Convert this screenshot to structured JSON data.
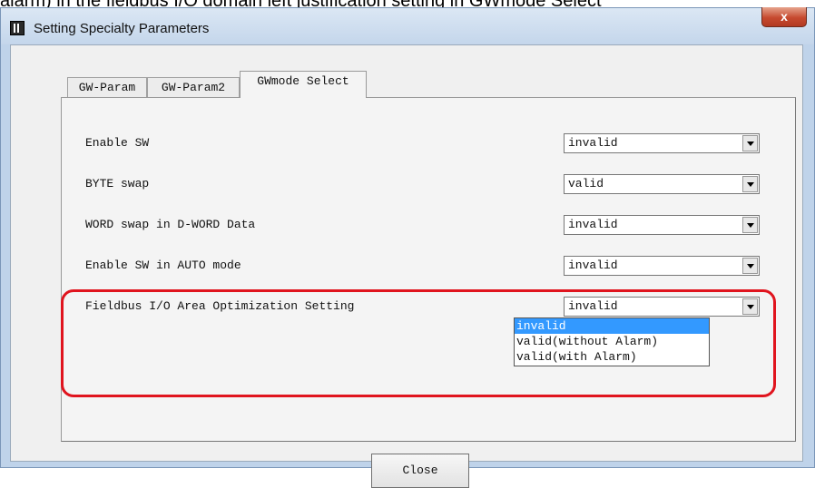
{
  "caption": "alarm) in the fieldbus I/O domain left justification setting in GWmode Select",
  "window": {
    "title": "Setting Specialty Parameters",
    "close_glyph": "x"
  },
  "tabs": [
    {
      "label": "GW-Param"
    },
    {
      "label": "GW-Param2"
    },
    {
      "label": "GWmode Select"
    }
  ],
  "settings": [
    {
      "label": "Enable SW",
      "value": "invalid"
    },
    {
      "label": "BYTE swap",
      "value": "valid"
    },
    {
      "label": "WORD swap in D-WORD Data",
      "value": "invalid"
    },
    {
      "label": "Enable SW in AUTO mode",
      "value": "invalid"
    },
    {
      "label": "Fieldbus I/O Area Optimization Setting",
      "value": "invalid"
    }
  ],
  "dropdown_options": [
    "invalid",
    "valid(without Alarm)",
    "valid(with Alarm)"
  ],
  "close_button_label": "Close",
  "colors": {
    "highlight": "#e0141e",
    "selected_option": "#3399ff",
    "window_frame": "#bfd3ea"
  }
}
